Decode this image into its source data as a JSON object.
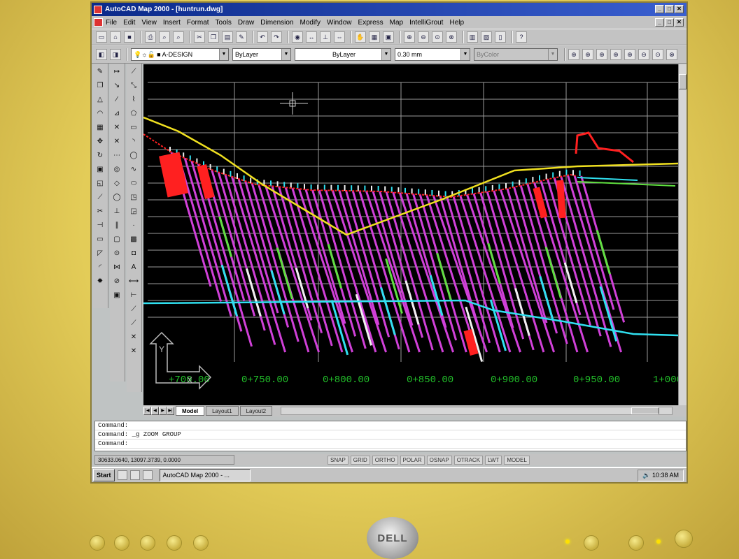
{
  "window": {
    "title": "AutoCAD Map 2000 - [huntrun.dwg]",
    "controls": [
      "_",
      "□",
      "✕"
    ]
  },
  "menu": [
    "File",
    "Edit",
    "View",
    "Insert",
    "Format",
    "Tools",
    "Draw",
    "Dimension",
    "Modify",
    "Window",
    "Express",
    "Map",
    "IntelliGrout",
    "Help"
  ],
  "properties": {
    "layer": "A-DESIGN",
    "color": "ByLayer",
    "linetype": "ByLayer",
    "lineweight": "0.30 mm",
    "plotstyle": "ByColor"
  },
  "chart_data": {
    "type": "line",
    "x_ticks": [
      "+700.00",
      "0+750.00",
      "0+800.00",
      "0+850.00",
      "0+900.00",
      "0+950.00",
      "1+000"
    ],
    "tick_color": "#22c02a"
  },
  "layout_tabs": [
    "Model",
    "Layout1",
    "Layout2"
  ],
  "command_window": {
    "lines": [
      "Command:",
      "Command:  _g ZOOM GROUP",
      "Command:"
    ]
  },
  "status": {
    "coords": "30633.0640, 13097.3739, 0.0000",
    "modes": [
      "SNAP",
      "GRID",
      "ORTHO",
      "POLAR",
      "OSNAP",
      "OTRACK",
      "LWT",
      "MODEL"
    ]
  },
  "taskbar": {
    "start": "Start",
    "task": "AutoCAD Map 2000 - ...",
    "clock": "10:38 AM"
  },
  "monitor": {
    "brand": "DELL"
  },
  "colors": {
    "magenta": "#d040d8",
    "cyan": "#30e0f0",
    "green": "#60e040",
    "yellow": "#f0e020",
    "red": "#ff2020",
    "white": "#f0f0f0",
    "grid": "#9a9a9a"
  }
}
